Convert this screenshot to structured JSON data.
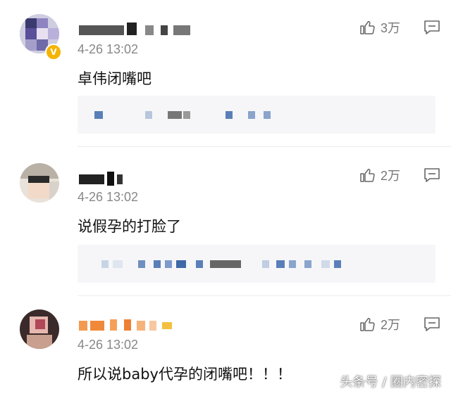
{
  "comments": [
    {
      "timestamp": "4-26 13:02",
      "text": "卓伟闭嘴吧",
      "likes": "3万",
      "verified": true,
      "verified_icon": "v-badge-icon",
      "like_icon": "thumbs-up-icon",
      "reply_icon": "comment-bubble-icon"
    },
    {
      "timestamp": "4-26 13:02",
      "text": "说假孕的打脸了",
      "likes": "2万",
      "verified": false,
      "like_icon": "thumbs-up-icon",
      "reply_icon": "comment-bubble-icon"
    },
    {
      "timestamp": "4-26 13:02",
      "text": "所以说baby代孕的闭嘴吧！！！",
      "likes": "2万",
      "verified": false,
      "like_icon": "thumbs-up-icon",
      "reply_icon": "comment-bubble-icon"
    }
  ],
  "watermark": "头条号 / 圈内密探",
  "colors": {
    "accent": "#f5b400",
    "muted": "#888888",
    "reply_bg": "#f6f6f8"
  }
}
